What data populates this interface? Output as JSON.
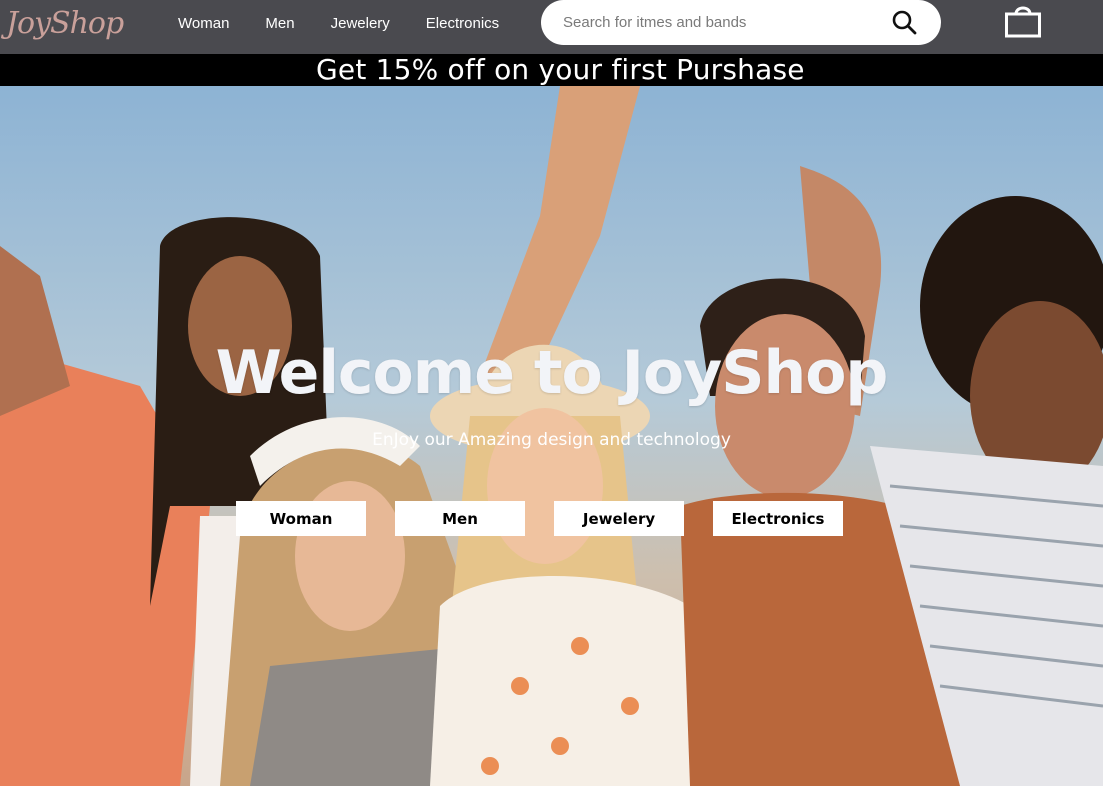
{
  "brand": {
    "logo_text": "JoyShop",
    "logo_color": "#c9a09a"
  },
  "nav": {
    "items": [
      {
        "label": "Woman"
      },
      {
        "label": "Men"
      },
      {
        "label": "Jewelery"
      },
      {
        "label": "Electronics"
      }
    ],
    "background": "#4a4a4f"
  },
  "search": {
    "placeholder": "Search for itmes and bands",
    "value": "",
    "icon": "search-icon"
  },
  "cart": {
    "icon": "shopping-bag-icon"
  },
  "promo": {
    "text": "Get 15% off on your first Purshase",
    "background": "#000000"
  },
  "hero": {
    "title": "Welcome to JoyShop",
    "subtitle": "EnJoy our Amazing design and technology",
    "buttons": [
      {
        "label": "Woman"
      },
      {
        "label": "Men"
      },
      {
        "label": "Jewelery"
      },
      {
        "label": "Electronics"
      }
    ]
  }
}
